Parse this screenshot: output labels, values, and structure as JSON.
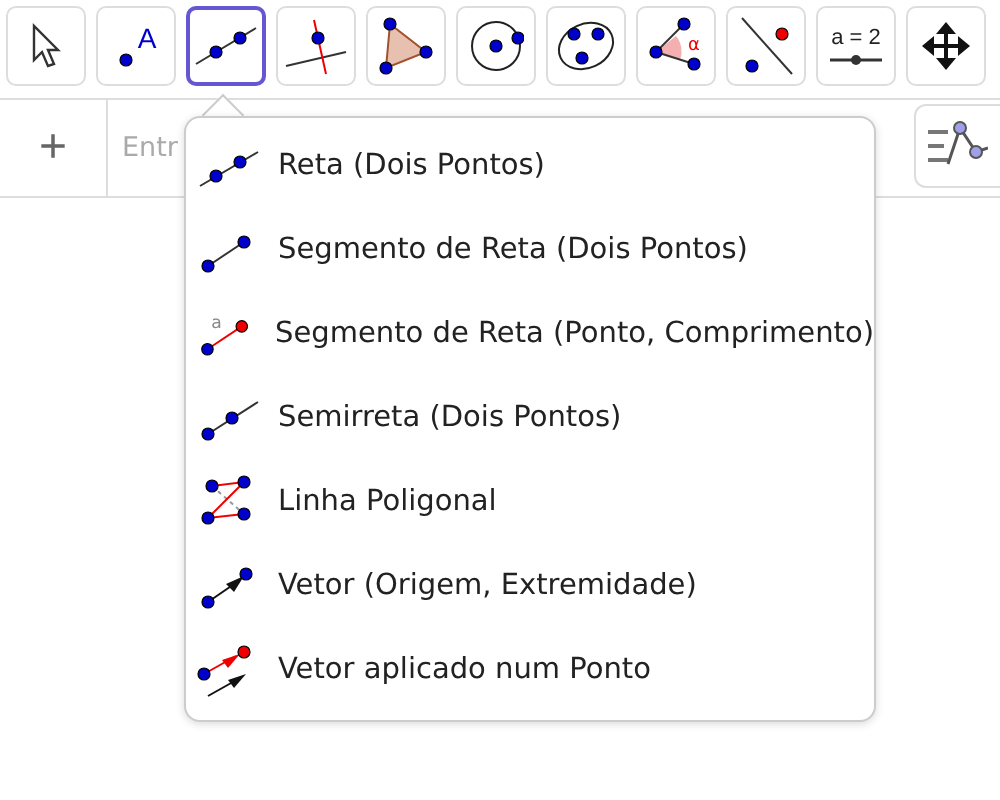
{
  "toolbar": {
    "tools": [
      {
        "kind": "move",
        "selected": false
      },
      {
        "kind": "point",
        "selected": false,
        "label": "A"
      },
      {
        "kind": "line",
        "selected": true
      },
      {
        "kind": "perpendicular",
        "selected": false
      },
      {
        "kind": "polygon",
        "selected": false
      },
      {
        "kind": "circle",
        "selected": false
      },
      {
        "kind": "conic",
        "selected": false
      },
      {
        "kind": "angle",
        "selected": false,
        "label": "α"
      },
      {
        "kind": "reflect",
        "selected": false
      },
      {
        "kind": "slider",
        "selected": false,
        "label": "a = 2"
      },
      {
        "kind": "move-view",
        "selected": false
      }
    ]
  },
  "input_bar": {
    "add_label": "+",
    "placeholder": "Entr"
  },
  "menu": {
    "items": [
      {
        "kind": "line",
        "label": "Reta (Dois Pontos)"
      },
      {
        "kind": "segment",
        "label": "Segmento de Reta (Dois Pontos)"
      },
      {
        "kind": "segment-length",
        "label": "Segmento de Reta (Ponto, Comprimento)",
        "icon_label": "a"
      },
      {
        "kind": "ray",
        "label": "Semirreta (Dois Pontos)"
      },
      {
        "kind": "polyline",
        "label": "Linha Poligonal"
      },
      {
        "kind": "vector",
        "label": "Vetor (Origem, Extremidade)"
      },
      {
        "kind": "vector-from-point",
        "label": "Vetor aplicado num Ponto"
      }
    ]
  }
}
